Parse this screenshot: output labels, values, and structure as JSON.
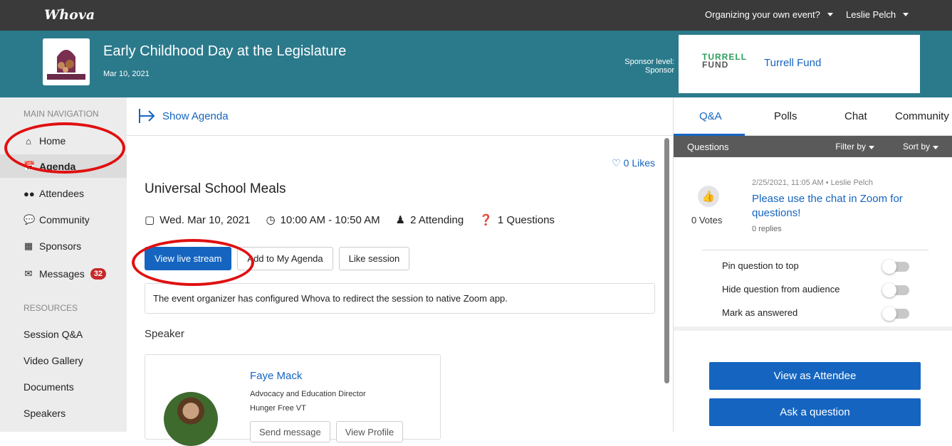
{
  "topbar": {
    "logo": "Whova",
    "organizing": "Organizing your own event?",
    "user": "Leslie Pelch"
  },
  "event": {
    "title": "Early Childhood Day at the Legislature",
    "date": "Mar 10, 2021",
    "sponsor_level_label": "Sponsor level:",
    "sponsor_level_value": "Sponsor",
    "sponsor_logo_line1": "TURRELL",
    "sponsor_logo_line2": "FUND",
    "sponsor_name": "Turrell Fund"
  },
  "sidebar": {
    "main_heading": "MAIN NAVIGATION",
    "items": [
      {
        "label": "Home",
        "icon": "home-icon"
      },
      {
        "label": "Agenda",
        "icon": "calendar-icon"
      },
      {
        "label": "Attendees",
        "icon": "people-icon"
      },
      {
        "label": "Community",
        "icon": "chat-bubbles-icon"
      },
      {
        "label": "Sponsors",
        "icon": "building-icon"
      },
      {
        "label": "Messages",
        "icon": "envelope-icon",
        "badge": "32"
      }
    ],
    "resources_heading": "RESOURCES",
    "resources": [
      "Session Q&A",
      "Video Gallery",
      "Documents",
      "Speakers"
    ]
  },
  "main": {
    "show_agenda": "Show Agenda",
    "likes": "0 Likes",
    "session_title": "Universal School Meals",
    "date": "Wed. Mar 10, 2021",
    "time": "10:00 AM - 10:50 AM",
    "attending": "2 Attending",
    "questions": "1 Questions",
    "btn_live": "View live stream",
    "btn_add": "Add to My Agenda",
    "btn_like": "Like session",
    "notice": "The event organizer has configured Whova to redirect the session to native Zoom app.",
    "speaker_heading": "Speaker",
    "speaker": {
      "name": "Faye Mack",
      "role": "Advocacy and Education Director",
      "org": "Hunger Free VT",
      "btn_message": "Send message",
      "btn_profile": "View Profile"
    }
  },
  "right": {
    "tabs": [
      "Q&A",
      "Polls",
      "Chat",
      "Community"
    ],
    "questions_label": "Questions",
    "filter_label": "Filter by",
    "sort_label": "Sort by",
    "question": {
      "meta": "2/25/2021, 11:05 AM • Leslie Pelch",
      "text": "Please use the chat in Zoom for questions!",
      "replies": "0 replies",
      "votes": "0 Votes"
    },
    "options": [
      "Pin question to top",
      "Hide question from audience",
      "Mark as answered"
    ],
    "btn_view_attendee": "View as Attendee",
    "btn_ask": "Ask a question"
  },
  "colors": {
    "teal_header": "#2b7a8c",
    "accent_blue": "#1565c0",
    "annotation_red": "#e01010"
  }
}
